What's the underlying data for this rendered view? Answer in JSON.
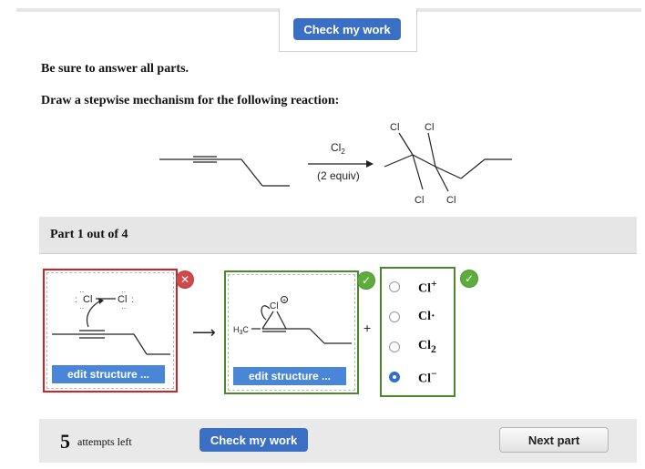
{
  "header": {
    "check_label": "Check my work"
  },
  "instructions": {
    "line1": "Be sure to answer all parts.",
    "line2": "Draw a stepwise mechanism for the following reaction:"
  },
  "reaction": {
    "reagent": "Cl",
    "reagent_sub": "2",
    "conditions": "(2 equiv)",
    "product_labels": [
      "Cl",
      "Cl",
      "Cl",
      "Cl"
    ]
  },
  "part": {
    "label": "Part 1 out of 4"
  },
  "structure1": {
    "atom_left": "Cl",
    "atom_right": "Cl",
    "edit_label": "edit structure ...",
    "status": "x"
  },
  "structure2": {
    "methyl": "H",
    "methyl_sub": "3",
    "methyl_c": "C",
    "ring_atom": "Cl",
    "edit_label": "edit structure ...",
    "status": "check"
  },
  "plus": "+",
  "arrow": "⟶",
  "options": {
    "items": [
      {
        "text": "Cl",
        "sup": "+",
        "sub": "",
        "selected": false
      },
      {
        "text": "Cl·",
        "sup": "",
        "sub": "",
        "selected": false
      },
      {
        "text": "Cl",
        "sup": "",
        "sub": "2",
        "selected": false
      },
      {
        "text": "Cl",
        "sup": "−",
        "sub": "",
        "selected": true
      }
    ],
    "status": "check"
  },
  "footer": {
    "attempts_count": "5",
    "attempts_text": "attempts left",
    "check_label": "Check my work",
    "next_label": "Next part"
  },
  "colors": {
    "primary_button": "#3a6fc4",
    "error": "#d42020",
    "success": "#4a8a2a"
  }
}
